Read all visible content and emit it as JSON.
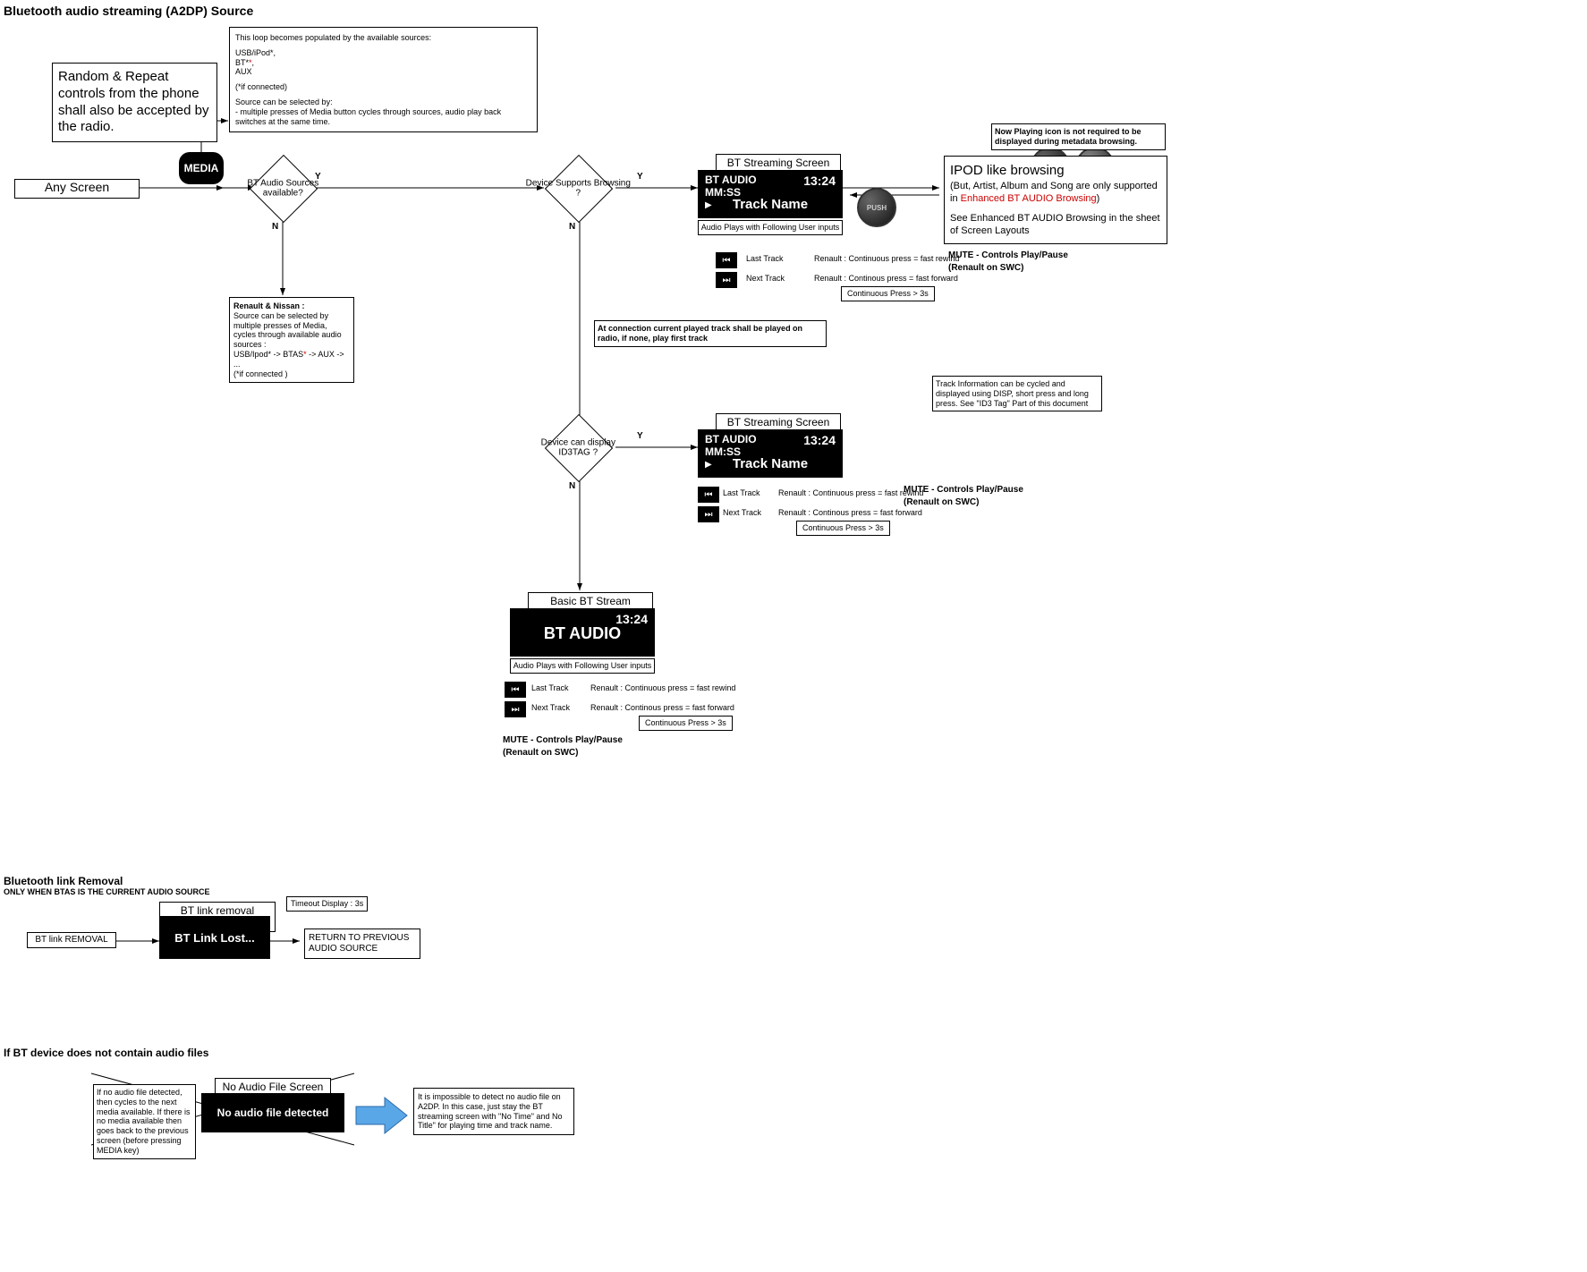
{
  "title": "Bluetooth audio streaming (A2DP) Source",
  "note_random_repeat": "Random & Repeat controls from the phone shall also be accepted by the radio.",
  "loop_note": {
    "line1": "This loop becomes populated by the available sources:",
    "usb": "USB/iPod*,",
    "bt": "BT*",
    "bt_suffix": ",",
    "aux": "AUX",
    "cond": "(*if connected)",
    "sel1": "Source can be selected by:",
    "sel2": "- multiple presses of Media button cycles through sources,  audio play back switches at the same time."
  },
  "any_screen": "Any Screen",
  "media_btn": "MEDIA",
  "decision_bt": "BT Audio Sources available?",
  "label_y": "Y",
  "label_n": "N",
  "renault_note": {
    "head": "Renault & Nissan :",
    "l1": "Source can be selected by multiple presses of Media, cycles through available audio sources :",
    "l2": "USB/Ipod* -> BTAS* -> AUX -> ...",
    "l3": "(*if connected )"
  },
  "decision_browse": "Device Supports Browsing ?",
  "screen1_title": "BT Streaming Screen",
  "screen1_top": "BT AUDIO",
  "screen1_mm": "MM:SS",
  "screen1_clock": "13:24",
  "screen1_track": "Track Name",
  "audio_plays": "Audio Plays with Following User inputs",
  "now_playing_note": "Now Playing icon is not required to be displayed during metadata browsing.",
  "ipod_title": "IPOD like browsing",
  "ipod_l1": "(But, Artist, Album and Song are only supported",
  "ipod_l2": "in ",
  "ipod_l2_red": "Enhanced BT AUDIO Browsing",
  "ipod_l2_end": ")",
  "ipod_l3": "See Enhanced BT AUDIO Browsing in the sheet of Screen Layouts",
  "last_track": "Last Track",
  "next_track": "Next Track",
  "renault_rewind": "Renault : Continuous press = fast rewind",
  "renault_forward": "Renault : Continous press = fast forward",
  "cont_press": "Continuous Press > 3s",
  "mute_note": "MUTE - Controls Play/Pause",
  "mute_note_sub": "(Renault on SWC)",
  "conn_note": "At connection current played track shall be played on radio, if none, play first track",
  "track_info_note": "Track Information can be cycled and displayed using DISP, short press and long press. See \"ID3 Tag\" Part of this document",
  "decision_id3": "Device can display ID3TAG ?",
  "screen2_title": "BT Streaming Screen",
  "screen3_title": "Basic BT Stream Screen",
  "screen3_main": "BT AUDIO",
  "removal_title": "Bluetooth link Removal",
  "removal_sub": "ONLY WHEN BTAS IS THE CURRENT AUDIO SOURCE",
  "bt_link_removal": "BT link REMOVAL",
  "removal_screen_title": "BT link removal screen",
  "removal_screen_text": "BT Link Lost...",
  "timeout": "Timeout Display : 3s",
  "return_prev": "RETURN TO PREVIOUS AUDIO SOURCE",
  "no_audio_title": "If BT device does not contain audio files",
  "no_audio_note": "If no audio file detected, then cycles to the next media available. If there is no media available then goes back to the previous screen (before pressing MEDIA key)",
  "no_audio_screen_title": "No Audio File Screen",
  "no_audio_screen_text": "No audio file detected",
  "no_audio_explain": "It is impossible to detect no audio file on A2DP. In this case, just stay the BT streaming screen with \"No Time\" and No Title\" for playing time and track name.",
  "push_label": "PUSH"
}
